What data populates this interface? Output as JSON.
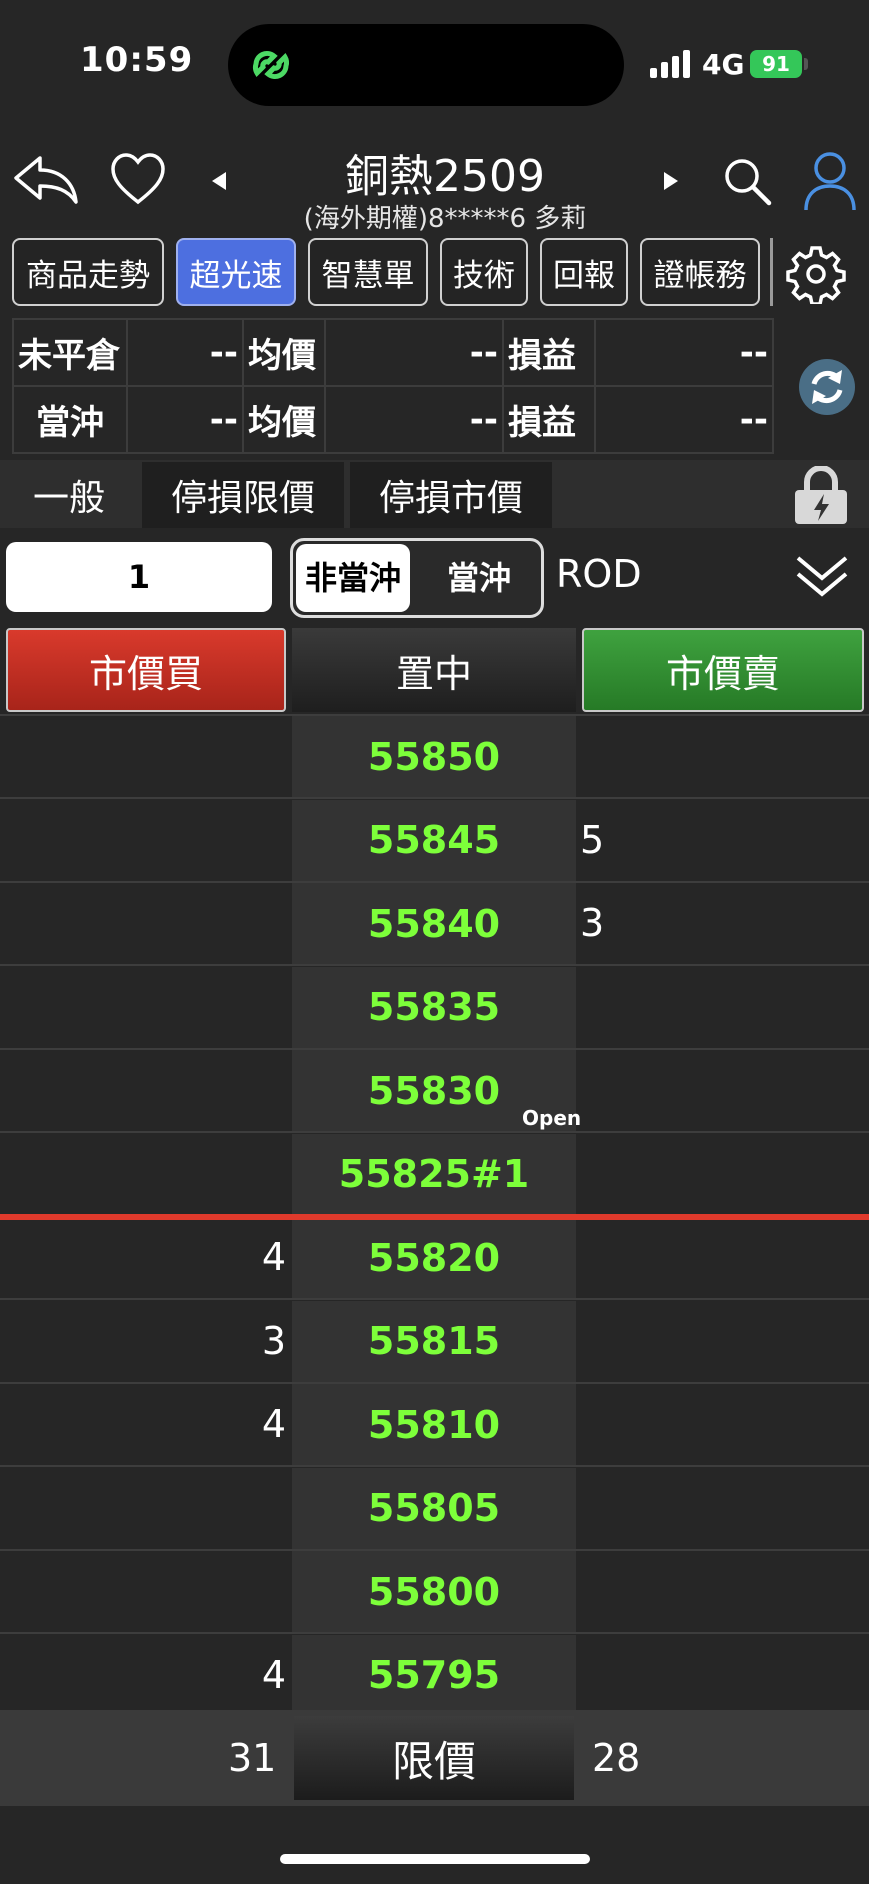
{
  "status_bar": {
    "time": "10:59",
    "network": "4G",
    "battery": "91"
  },
  "header": {
    "title": "銅熱2509",
    "subtitle": "(海外期權)8*****6  多莉"
  },
  "tabs": [
    {
      "label": "商品走勢",
      "active": false
    },
    {
      "label": "超光速",
      "active": true
    },
    {
      "label": "智慧單",
      "active": false
    },
    {
      "label": "技術",
      "active": false
    },
    {
      "label": "回報",
      "active": false
    },
    {
      "label": "證帳務",
      "active": false
    }
  ],
  "positions": [
    {
      "label": "未平倉",
      "value": "--",
      "avg_label": "均價",
      "avg": "--",
      "pnl_label": "損益",
      "pnl": "--"
    },
    {
      "label": "當沖",
      "value": "--",
      "avg_label": "均價",
      "avg": "--",
      "pnl_label": "損益",
      "pnl": "--"
    }
  ],
  "order_types": [
    "一般",
    "停損限價",
    "停損市價"
  ],
  "order": {
    "quantity": "1",
    "daytrade_off": "非當沖",
    "daytrade_on": "當沖",
    "time_in_force": "ROD"
  },
  "ladder_header": {
    "buy": "市價買",
    "center": "置中",
    "sell": "市價賣"
  },
  "ladder": [
    {
      "price": "55850",
      "bid": "",
      "ask": ""
    },
    {
      "price": "55845",
      "bid": "",
      "ask": "5"
    },
    {
      "price": "55840",
      "bid": "",
      "ask": "3"
    },
    {
      "price": "55835",
      "bid": "",
      "ask": ""
    },
    {
      "price": "55830",
      "bid": "",
      "ask": ""
    },
    {
      "price": "55825#1",
      "bid": "",
      "ask": ""
    },
    {
      "price": "55820",
      "bid": "4",
      "ask": ""
    },
    {
      "price": "55815",
      "bid": "3",
      "ask": ""
    },
    {
      "price": "55810",
      "bid": "4",
      "ask": ""
    },
    {
      "price": "55805",
      "bid": "",
      "ask": ""
    },
    {
      "price": "55800",
      "bid": "",
      "ask": ""
    },
    {
      "price": "55795",
      "bid": "4",
      "ask": ""
    }
  ],
  "open_marker": "Open",
  "footer": {
    "bid_total": "31",
    "limit_label": "限價",
    "ask_total": "28"
  },
  "colors": {
    "accent_blue": "#4d6fe0",
    "buy_red": "#d93a2c",
    "sell_green": "#3fa23f",
    "price_green": "#7dff3a"
  }
}
